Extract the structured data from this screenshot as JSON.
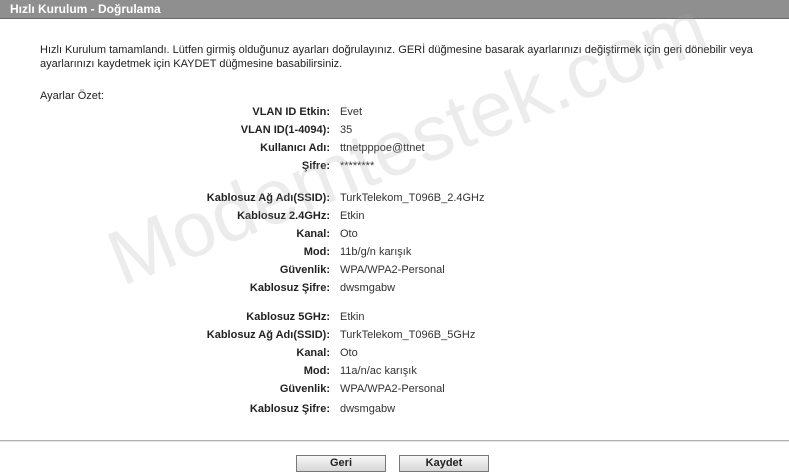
{
  "header": {
    "title": "Hızlı Kurulum - Doğrulama"
  },
  "intro_text": "Hızlı Kurulum tamamlandı. Lütfen girmiş olduğunuz ayarları doğrulayınız. GERİ düğmesine basarak ayarlarınızı değiştirmek için geri dönebilir veya ayarlarınızı kaydetmek için KAYDET düğmesine basabilirsiniz.",
  "summary_label": "Ayarlar Özet:",
  "rows": [
    {
      "label": "VLAN ID Etkin:",
      "value": "Evet"
    },
    {
      "label": "VLAN ID(1-4094):",
      "value": "35"
    },
    {
      "label": "Kullanıcı Adı:",
      "value": "ttnetpppoe@ttnet"
    },
    {
      "label": "Şifre:",
      "value": "********"
    },
    {
      "label": "Kablosuz Ağ Adı(SSID):",
      "value": "TurkTelekom_T096B_2.4GHz"
    },
    {
      "label": "Kablosuz 2.4GHz:",
      "value": "Etkin"
    },
    {
      "label": "Kanal:",
      "value": "Oto"
    },
    {
      "label": "Mod:",
      "value": "11b/g/n karışık"
    },
    {
      "label": "Güvenlik:",
      "value": "WPA/WPA2-Personal"
    },
    {
      "label": "Kablosuz Şifre:",
      "value": "dwsmgabw"
    },
    {
      "label": "Kablosuz 5GHz:",
      "value": "Etkin"
    },
    {
      "label": "Kablosuz Ağ Adı(SSID):",
      "value": "TurkTelekom_T096B_5GHz"
    },
    {
      "label": "Kanal:",
      "value": "Oto"
    },
    {
      "label": "Mod:",
      "value": "11a/n/ac karışık"
    },
    {
      "label": "Güvenlik:",
      "value": "WPA/WPA2-Personal"
    },
    {
      "label": "Kablosuz Şifre:",
      "value": "dwsmgabw"
    }
  ],
  "buttons": {
    "back": "Geri",
    "save": "Kaydet"
  },
  "watermark": "Modemtestek.com"
}
